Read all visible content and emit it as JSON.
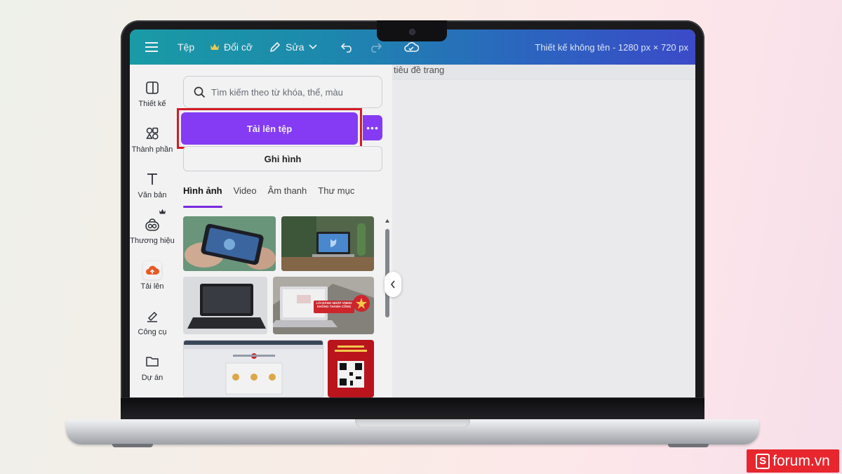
{
  "topbar": {
    "menu_icon": "hamburger-icon",
    "file_label": "Tệp",
    "resize_label": "Đổi cỡ",
    "edit_label": "Sửa",
    "title": "Thiết kế không tên - 1280 px × 720 px"
  },
  "sidebar": {
    "items": [
      {
        "label": "Thiết kế",
        "icon": "layout-icon"
      },
      {
        "label": "Thành phần",
        "icon": "shapes-icon"
      },
      {
        "label": "Văn bản",
        "icon": "text-icon"
      },
      {
        "label": "Thương hiệu",
        "icon": "brand-icon"
      },
      {
        "label": "Tải lên",
        "icon": "cloud-upload-icon"
      },
      {
        "label": "Công cụ",
        "icon": "pen-tool-icon"
      },
      {
        "label": "Dự án",
        "icon": "folder-icon"
      }
    ]
  },
  "panel": {
    "search_placeholder": "Tìm kiếm theo từ khóa, thể, màu",
    "upload_label": "Tải lên tệp",
    "more_label": "•••",
    "record_label": "Ghi hình",
    "tabs": [
      "Hình ảnh",
      "Video",
      "Âm thanh",
      "Thư mục"
    ],
    "active_tab": 0
  },
  "thumbs": {
    "banner_text": "LỖI ĐĂNG NHẬP VNEID KHÔNG THÀNH CÔNG"
  },
  "canvas": {
    "page_title_placeholder": "tiêu đề trang"
  },
  "watermark": {
    "letter": "S",
    "text": "forum.vn"
  },
  "colors": {
    "accent": "#8b3dff",
    "highlight": "#e01b24",
    "topbar_start": "#19a3ad",
    "topbar_end": "#3d4dd2"
  }
}
